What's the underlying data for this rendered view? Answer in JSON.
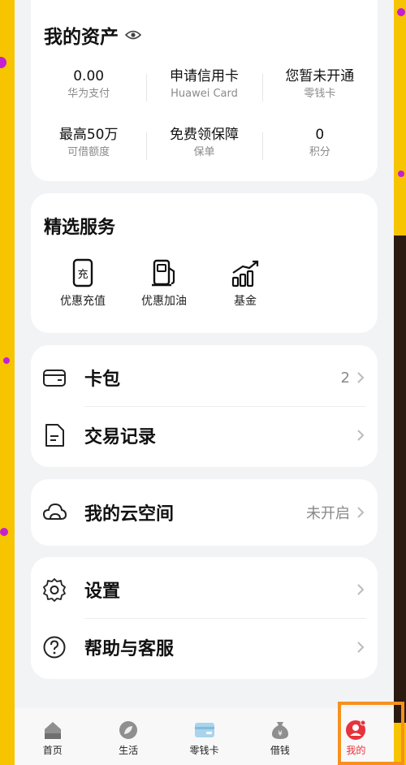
{
  "assets": {
    "title": "我的资产",
    "stats": [
      {
        "value": "0.00",
        "label": "华为支付"
      },
      {
        "value": "申请信用卡",
        "label": "Huawei Card"
      },
      {
        "value": "您暂未开通",
        "label": "零钱卡"
      },
      {
        "value": "最高50万",
        "label": "可借额度"
      },
      {
        "value": "免费领保障",
        "label": "保单"
      },
      {
        "value": "0",
        "label": "积分"
      }
    ]
  },
  "services": {
    "title": "精选服务",
    "items": [
      {
        "label": "优惠充值",
        "icon": "phone-recharge-icon"
      },
      {
        "label": "优惠加油",
        "icon": "fuel-icon"
      },
      {
        "label": "基金",
        "icon": "fund-chart-icon"
      }
    ]
  },
  "card_pack": {
    "items": [
      {
        "label": "卡包",
        "right": "2",
        "icon": "wallet-icon"
      },
      {
        "label": "交易记录",
        "right": "",
        "icon": "document-icon"
      }
    ]
  },
  "cloud": {
    "label": "我的云空间",
    "right": "未开启",
    "icon": "cloud-icon"
  },
  "settings": {
    "items": [
      {
        "label": "设置",
        "icon": "gear-icon"
      },
      {
        "label": "帮助与客服",
        "icon": "help-icon"
      }
    ]
  },
  "tabbar": {
    "tabs": [
      {
        "label": "首页",
        "icon": "home-icon"
      },
      {
        "label": "生活",
        "icon": "life-icon"
      },
      {
        "label": "零钱卡",
        "icon": "card-icon"
      },
      {
        "label": "借钱",
        "icon": "money-bag-icon"
      },
      {
        "label": "我的",
        "icon": "profile-icon"
      }
    ],
    "active": "我的"
  },
  "colors": {
    "background": "#f7c400",
    "accent": "#e8323c",
    "highlight": "#f7901e"
  }
}
